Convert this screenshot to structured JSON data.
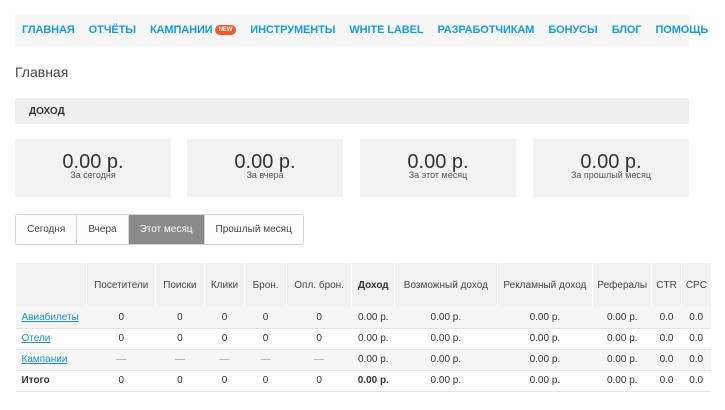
{
  "nav": {
    "items": [
      {
        "label": "ГЛАВНАЯ"
      },
      {
        "label": "ОТЧЁТЫ"
      },
      {
        "label": "КАМПАНИИ",
        "badge": "NEW"
      },
      {
        "label": "ИНСТРУМЕНТЫ"
      },
      {
        "label": "WHITE LABEL"
      },
      {
        "label": "РАЗРАБОТЧИКАМ"
      },
      {
        "label": "БОНУСЫ"
      },
      {
        "label": "БЛОГ"
      },
      {
        "label": "ПОМОЩЬ"
      }
    ]
  },
  "page": {
    "title": "Главная"
  },
  "income_section": {
    "title": "ДОХОД"
  },
  "cards": [
    {
      "value": "0.00 р.",
      "caption": "За сегодня"
    },
    {
      "value": "0.00 р.",
      "caption": "За вчера"
    },
    {
      "value": "0.00 р.",
      "caption": "За этот месяц"
    },
    {
      "value": "0.00 р.",
      "caption": "За прошлый месяц"
    }
  ],
  "period_tabs": [
    {
      "label": "Сегодня",
      "active": false
    },
    {
      "label": "Вчера",
      "active": false
    },
    {
      "label": "Этот месяц",
      "active": true
    },
    {
      "label": "Прошлый месяц",
      "active": false
    }
  ],
  "table": {
    "headers": [
      "",
      "Посетители",
      "Поиски",
      "Клики",
      "Брон.",
      "Опл. брон.",
      "Доход",
      "Возможный доход",
      "Рекламный доход",
      "Рефералы",
      "CTR",
      "CPC"
    ],
    "rows": [
      {
        "name": "Авиабилеты",
        "cells": [
          "0",
          "0",
          "0",
          "0",
          "0",
          "0.00 р.",
          "0.00 р.",
          "0.00 р.",
          "0.00 р.",
          "0.0",
          "0.0"
        ]
      },
      {
        "name": "Отели",
        "cells": [
          "0",
          "0",
          "0",
          "0",
          "0",
          "0.00 р.",
          "0.00 р.",
          "0.00 р.",
          "0.00 р.",
          "0.0",
          "0.0"
        ]
      },
      {
        "name": "Кампании",
        "cells": [
          "—",
          "—",
          "—",
          "—",
          "—",
          "0.00 р.",
          "0.00 р.",
          "0.00 р.",
          "0.00 р.",
          "0.0",
          "0.0"
        ]
      },
      {
        "name": "Итого",
        "cells": [
          "0",
          "0",
          "0",
          "0",
          "0",
          "0.00 р.",
          "0.00 р.",
          "0.00 р.",
          "0.00 р.",
          "0.0",
          "0.0"
        ]
      }
    ]
  },
  "colors": {
    "link": "#1a9bd6",
    "badge": "#f05a28",
    "active_tab": "#8a8a8a"
  }
}
